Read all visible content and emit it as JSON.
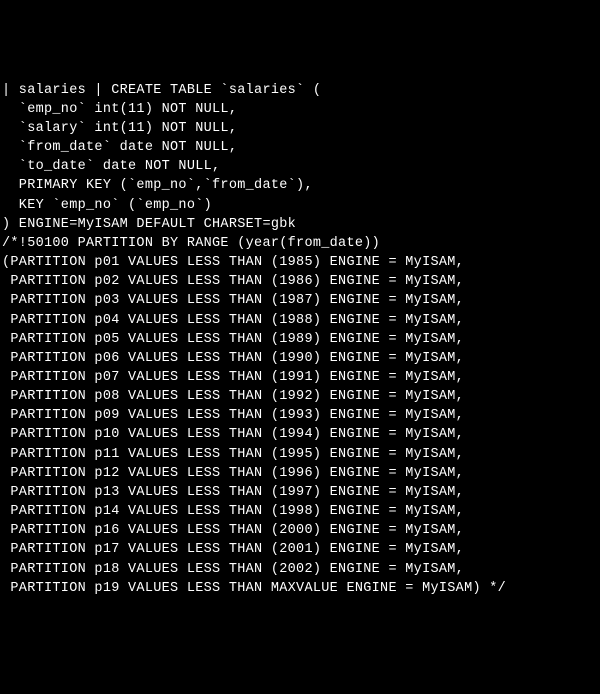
{
  "lines": [
    "| salaries | CREATE TABLE `salaries` (",
    "  `emp_no` int(11) NOT NULL,",
    "  `salary` int(11) NOT NULL,",
    "  `from_date` date NOT NULL,",
    "  `to_date` date NOT NULL,",
    "  PRIMARY KEY (`emp_no`,`from_date`),",
    "  KEY `emp_no` (`emp_no`)",
    ") ENGINE=MyISAM DEFAULT CHARSET=gbk",
    "/*!50100 PARTITION BY RANGE (year(from_date))",
    "(PARTITION p01 VALUES LESS THAN (1985) ENGINE = MyISAM,",
    " PARTITION p02 VALUES LESS THAN (1986) ENGINE = MyISAM,",
    " PARTITION p03 VALUES LESS THAN (1987) ENGINE = MyISAM,",
    " PARTITION p04 VALUES LESS THAN (1988) ENGINE = MyISAM,",
    " PARTITION p05 VALUES LESS THAN (1989) ENGINE = MyISAM,",
    " PARTITION p06 VALUES LESS THAN (1990) ENGINE = MyISAM,",
    " PARTITION p07 VALUES LESS THAN (1991) ENGINE = MyISAM,",
    " PARTITION p08 VALUES LESS THAN (1992) ENGINE = MyISAM,",
    " PARTITION p09 VALUES LESS THAN (1993) ENGINE = MyISAM,",
    " PARTITION p10 VALUES LESS THAN (1994) ENGINE = MyISAM,",
    " PARTITION p11 VALUES LESS THAN (1995) ENGINE = MyISAM,",
    " PARTITION p12 VALUES LESS THAN (1996) ENGINE = MyISAM,",
    " PARTITION p13 VALUES LESS THAN (1997) ENGINE = MyISAM,",
    " PARTITION p14 VALUES LESS THAN (1998) ENGINE = MyISAM,",
    " PARTITION p16 VALUES LESS THAN (2000) ENGINE = MyISAM,",
    " PARTITION p17 VALUES LESS THAN (2001) ENGINE = MyISAM,",
    " PARTITION p18 VALUES LESS THAN (2002) ENGINE = MyISAM,",
    " PARTITION p19 VALUES LESS THAN MAXVALUE ENGINE = MyISAM) */"
  ],
  "chart_data": {
    "type": "table",
    "table_name": "salaries",
    "engine": "MyISAM",
    "charset": "gbk",
    "columns": [
      {
        "name": "emp_no",
        "type": "int(11)",
        "nullable": false
      },
      {
        "name": "salary",
        "type": "int(11)",
        "nullable": false
      },
      {
        "name": "from_date",
        "type": "date",
        "nullable": false
      },
      {
        "name": "to_date",
        "type": "date",
        "nullable": false
      }
    ],
    "primary_key": [
      "emp_no",
      "from_date"
    ],
    "keys": [
      {
        "name": "emp_no",
        "columns": [
          "emp_no"
        ]
      }
    ],
    "partition_by": "RANGE (year(from_date))",
    "partitions": [
      {
        "name": "p01",
        "less_than": 1985,
        "engine": "MyISAM"
      },
      {
        "name": "p02",
        "less_than": 1986,
        "engine": "MyISAM"
      },
      {
        "name": "p03",
        "less_than": 1987,
        "engine": "MyISAM"
      },
      {
        "name": "p04",
        "less_than": 1988,
        "engine": "MyISAM"
      },
      {
        "name": "p05",
        "less_than": 1989,
        "engine": "MyISAM"
      },
      {
        "name": "p06",
        "less_than": 1990,
        "engine": "MyISAM"
      },
      {
        "name": "p07",
        "less_than": 1991,
        "engine": "MyISAM"
      },
      {
        "name": "p08",
        "less_than": 1992,
        "engine": "MyISAM"
      },
      {
        "name": "p09",
        "less_than": 1993,
        "engine": "MyISAM"
      },
      {
        "name": "p10",
        "less_than": 1994,
        "engine": "MyISAM"
      },
      {
        "name": "p11",
        "less_than": 1995,
        "engine": "MyISAM"
      },
      {
        "name": "p12",
        "less_than": 1996,
        "engine": "MyISAM"
      },
      {
        "name": "p13",
        "less_than": 1997,
        "engine": "MyISAM"
      },
      {
        "name": "p14",
        "less_than": 1998,
        "engine": "MyISAM"
      },
      {
        "name": "p16",
        "less_than": 2000,
        "engine": "MyISAM"
      },
      {
        "name": "p17",
        "less_than": 2001,
        "engine": "MyISAM"
      },
      {
        "name": "p18",
        "less_than": 2002,
        "engine": "MyISAM"
      },
      {
        "name": "p19",
        "less_than": "MAXVALUE",
        "engine": "MyISAM"
      }
    ]
  }
}
